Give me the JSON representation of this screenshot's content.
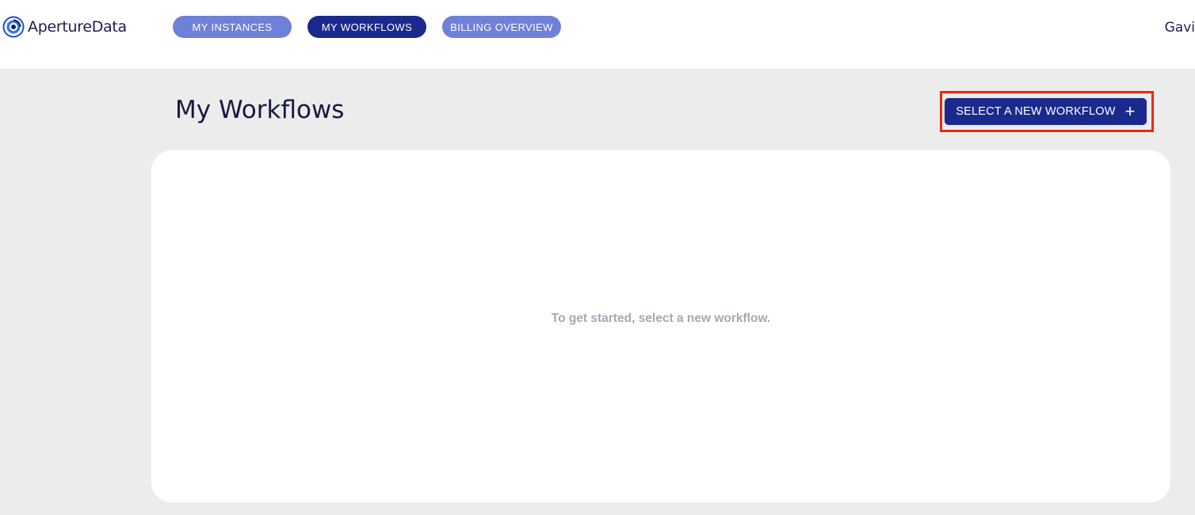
{
  "brand": {
    "name": "ApertureData"
  },
  "nav": {
    "items": [
      {
        "label": "MY INSTANCES",
        "active": false
      },
      {
        "label": "MY WORKFLOWS",
        "active": true
      },
      {
        "label": "BILLING OVERVIEW",
        "active": false
      }
    ]
  },
  "user": {
    "name": "Gavi"
  },
  "page": {
    "title": "My Workflows",
    "action_label": "SELECT A NEW WORKFLOW",
    "action_icon": "+",
    "empty_message": "To get started, select a new workflow."
  },
  "colors": {
    "primary": "#1a2a8c",
    "nav_inactive": "#6f80d8",
    "background": "#ececec",
    "highlight": "#ee2a00",
    "muted_text": "#a5a8b2"
  }
}
